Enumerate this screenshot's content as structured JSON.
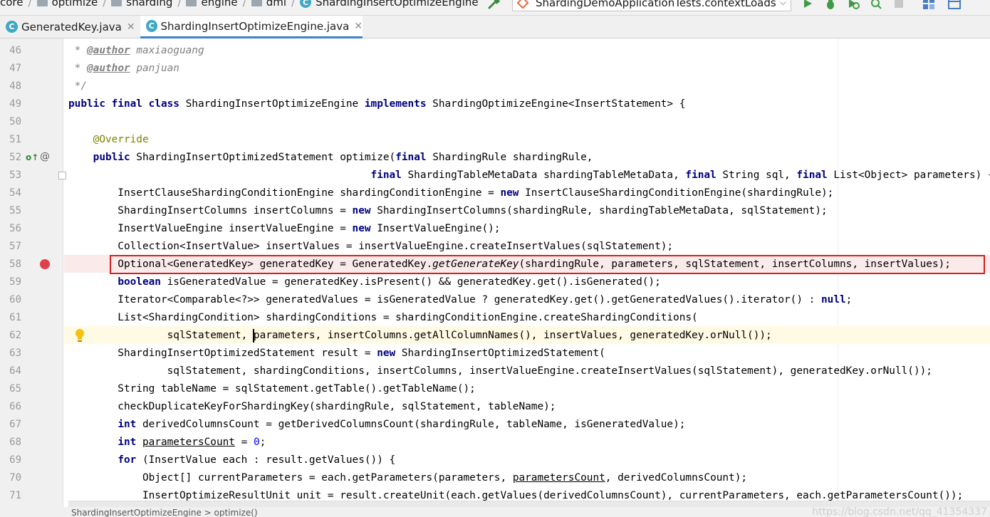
{
  "breadcrumb": {
    "items": [
      {
        "label": "core",
        "icon": "folder-icon"
      },
      {
        "label": "optimize",
        "icon": "folder-icon"
      },
      {
        "label": "sharding",
        "icon": "folder-icon"
      },
      {
        "label": "engine",
        "icon": "folder-icon"
      },
      {
        "label": "dml",
        "icon": "folder-icon"
      },
      {
        "label": "ShardingInsertOptimizeEngine",
        "icon": "class-icon"
      }
    ],
    "class_icon_letter": "C"
  },
  "toolbar": {
    "run_config_label": "ShardingDemoApplicationTests.contextLoads",
    "icons": [
      "build-icon",
      "run-icon",
      "debug-icon",
      "coverage-icon",
      "profile-icon",
      "stop-icon",
      "project-structure-icon",
      "search-everywhere-icon"
    ]
  },
  "tabs": [
    {
      "label": "GeneratedKey.java",
      "active": false,
      "icon_letter": "C"
    },
    {
      "label": "ShardingInsertOptimizeEngine.java",
      "active": true,
      "icon_letter": "C"
    }
  ],
  "editor": {
    "current_line": 62,
    "breakpoint_line": 58,
    "lines": [
      46,
      47,
      48,
      49,
      50,
      51,
      52,
      53,
      54,
      55,
      56,
      57,
      58,
      59,
      60,
      61,
      62,
      63,
      64,
      65,
      66,
      67,
      68,
      69,
      70,
      71
    ]
  },
  "status": {
    "text": "ShardingInsertOptimizeEngine > optimize()",
    "watermark": "https://blog.csdn.net/qq_41354337"
  },
  "colors": {
    "keyword": "#000080",
    "comment": "#808080",
    "annotation": "#808000",
    "number": "#0000ff",
    "breakpoint": "#e0404a",
    "highlight_box": "#d32020",
    "current_line": "#fffae3",
    "active_tab_underline": "#4083c9"
  }
}
